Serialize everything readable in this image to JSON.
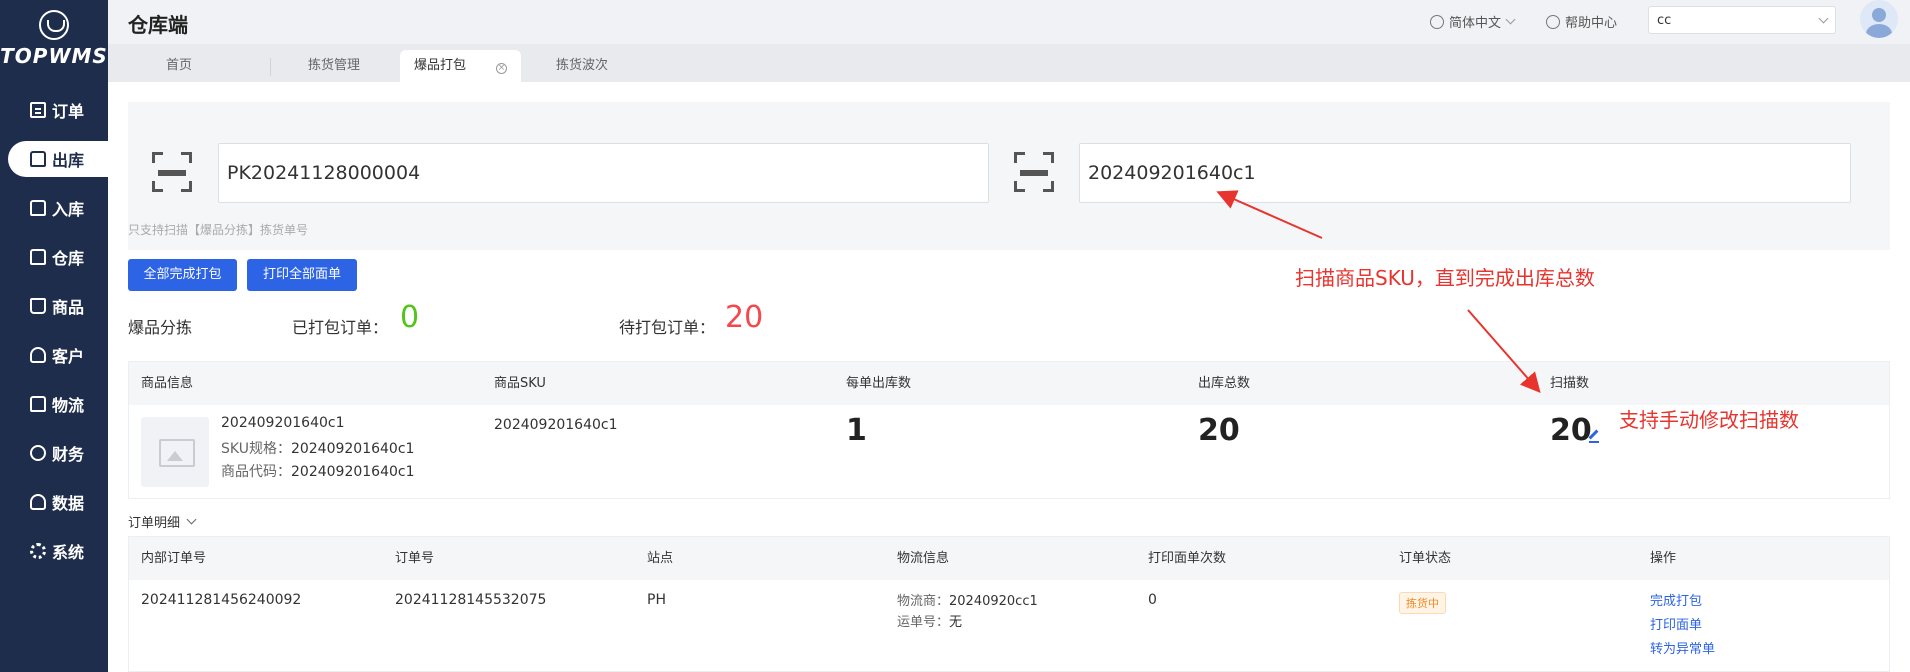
{
  "logo": {
    "text": "TOPWMS"
  },
  "sidebar": {
    "items": [
      {
        "label": "订单",
        "icon": "order-icon"
      },
      {
        "label": "出库",
        "icon": "outbound-icon"
      },
      {
        "label": "入库",
        "icon": "inbound-icon"
      },
      {
        "label": "仓库",
        "icon": "warehouse-icon"
      },
      {
        "label": "商品",
        "icon": "product-icon"
      },
      {
        "label": "客户",
        "icon": "customer-icon"
      },
      {
        "label": "物流",
        "icon": "logistics-icon"
      },
      {
        "label": "财务",
        "icon": "finance-icon"
      },
      {
        "label": "数据",
        "icon": "data-icon"
      },
      {
        "label": "系统",
        "icon": "settings-icon"
      }
    ],
    "active_index": 1
  },
  "header": {
    "title": "仓库端",
    "language": "简体中文",
    "help": "帮助中心",
    "user_select": "cc"
  },
  "tabs": [
    {
      "label": "首页"
    },
    {
      "label": "拣货管理"
    },
    {
      "label": "爆品打包"
    },
    {
      "label": "拣货波次"
    }
  ],
  "scan": {
    "picking_no": "PK20241128000004",
    "sku_value": "202409201640c1",
    "hint": "只支持扫描【爆品分拣】拣货单号"
  },
  "buttons": {
    "complete_all": "全部完成打包",
    "print_all": "打印全部面单"
  },
  "stats": {
    "section_label": "爆品分拣",
    "packed_label": "已打包订单：",
    "packed_value": "0",
    "pending_label": "待打包订单：",
    "pending_value": "20"
  },
  "annotations": {
    "scan_sku": "扫描商品SKU，直到完成出库总数",
    "manual_edit": "支持手动修改扫描数"
  },
  "product_table": {
    "headers": [
      "商品信息",
      "商品SKU",
      "每单出库数",
      "出库总数",
      "扫描数"
    ],
    "row": {
      "name": "202409201640c1",
      "spec_label": "SKU规格：",
      "spec_value": "202409201640c1",
      "code_label": "商品代码：",
      "code_value": "202409201640c1",
      "sku": "202409201640c1",
      "per_order": "1",
      "total": "20",
      "scanned": "20"
    }
  },
  "order_detail_label": "订单明细",
  "order_table": {
    "headers": [
      "内部订单号",
      "订单号",
      "站点",
      "物流信息",
      "打印面单次数",
      "订单状态",
      "操作"
    ],
    "row": {
      "internal_no": "202411281456240092",
      "order_no": "20241128145532075",
      "site": "PH",
      "carrier_label": "物流商：",
      "carrier_value": "20240920cc1",
      "waybill_label": "运单号：",
      "waybill_value": "无",
      "print_count": "0",
      "status": "拣货中",
      "actions": [
        "完成打包",
        "打印面单",
        "转为异常单"
      ]
    }
  },
  "colors": {
    "sidebar": "#1f2d4d",
    "primary": "#2d63e5",
    "success": "#52c41a",
    "danger": "#f5484d",
    "annotation": "#e8342e"
  }
}
